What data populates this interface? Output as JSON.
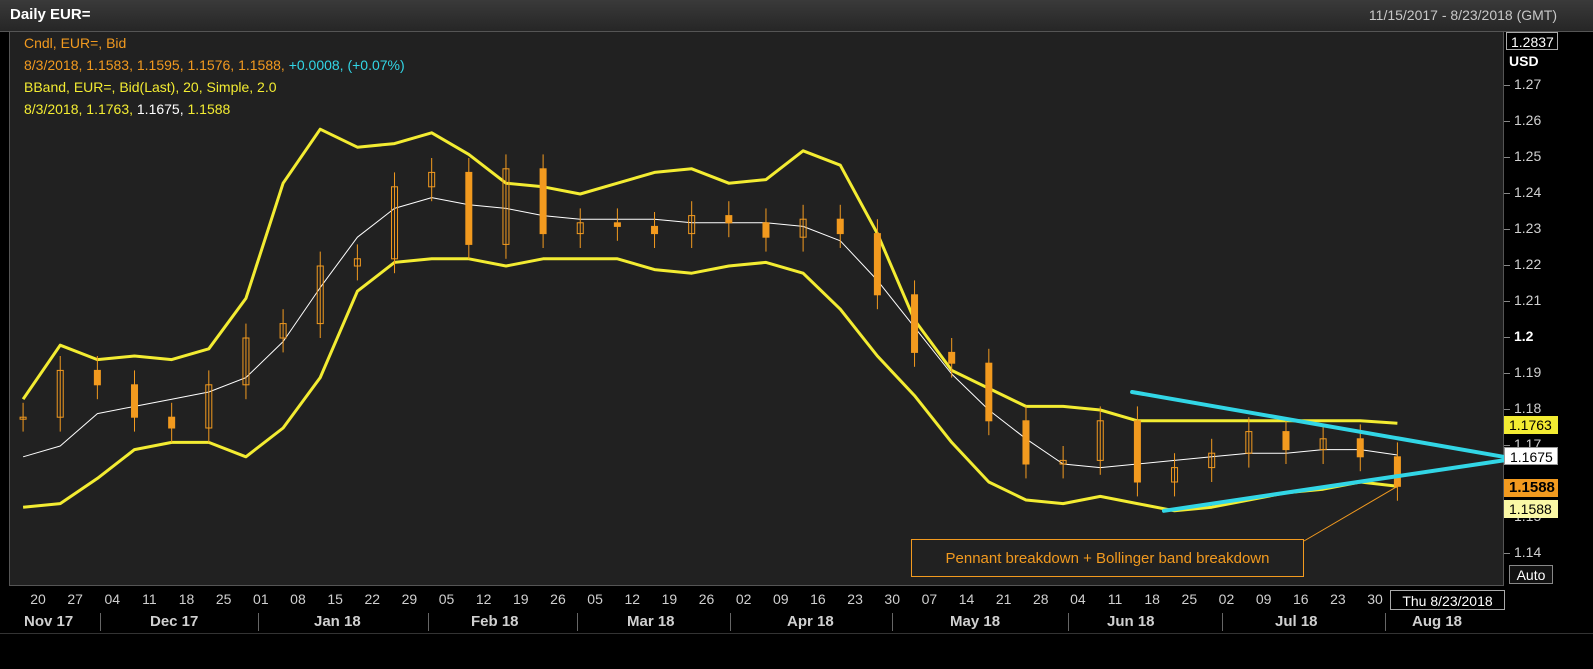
{
  "window": {
    "title": "Daily EUR=",
    "date_range": "11/15/2017 - 8/23/2018 (GMT)"
  },
  "legend": {
    "line1": "Cndl, EUR=, Bid",
    "line2_prefix": "8/3/2018, 1.1583, 1.1595, 1.1576, 1.1588, ",
    "line2_change": "+0.0008, (+0.07%)",
    "line3": "BBand, EUR=, Bid(Last),  20, Simple, 2.0",
    "line4_date": "8/3/2018, ",
    "line4_upper": "1.1763, ",
    "line4_mid": "1.1675, ",
    "line4_lower": "1.1588"
  },
  "yaxis": {
    "unit": "USD",
    "top_value": "1.2837",
    "labels": [
      "1.27",
      "1.26",
      "1.25",
      "1.24",
      "1.23",
      "1.22",
      "1.21",
      "1.2",
      "1.19",
      "1.18",
      "1.17",
      "1.15",
      "1.14"
    ],
    "tags": {
      "upper": "1.1763",
      "mid": "1.1675",
      "last": "1.1588",
      "lower": "1.1588"
    },
    "auto_label": "Auto"
  },
  "xaxis": {
    "day_labels": [
      "20",
      "27",
      "04",
      "11",
      "18",
      "25",
      "01",
      "08",
      "15",
      "22",
      "29",
      "05",
      "12",
      "19",
      "26",
      "05",
      "12",
      "19",
      "26",
      "02",
      "09",
      "16",
      "23",
      "30",
      "07",
      "14",
      "21",
      "28",
      "04",
      "11",
      "18",
      "25",
      "02",
      "09",
      "16",
      "23",
      "30"
    ],
    "months": [
      "Nov 17",
      "Dec 17",
      "Jan 18",
      "Feb 18",
      "Mar 18",
      "Apr 18",
      "May 18",
      "Jun 18",
      "Jul 18",
      "Aug 18"
    ],
    "cursor_date": "Thu 8/23/2018"
  },
  "annotation": "Pennant breakdown + Bollinger band breakdown",
  "colors": {
    "candle": "#f29a1f",
    "band": "#f3ec32",
    "middle": "#ffffff",
    "trendline": "#32d6e6",
    "background": "#212121"
  },
  "chart_data": {
    "type": "candlestick",
    "series": [
      {
        "name": "EUR= Bid",
        "dates": [
          "2017-11-17",
          "2017-11-24",
          "2017-12-01",
          "2017-12-08",
          "2017-12-15",
          "2017-12-22",
          "2017-12-29",
          "2018-01-05",
          "2018-01-12",
          "2018-01-19",
          "2018-01-26",
          "2018-02-02",
          "2018-02-09",
          "2018-02-16",
          "2018-02-23",
          "2018-03-02",
          "2018-03-09",
          "2018-03-16",
          "2018-03-23",
          "2018-03-30",
          "2018-04-06",
          "2018-04-13",
          "2018-04-20",
          "2018-04-27",
          "2018-05-04",
          "2018-05-11",
          "2018-05-18",
          "2018-05-25",
          "2018-06-01",
          "2018-06-08",
          "2018-06-15",
          "2018-06-22",
          "2018-06-29",
          "2018-07-06",
          "2018-07-13",
          "2018-07-20",
          "2018-07-27",
          "2018-08-03"
        ],
        "close": [
          1.178,
          1.191,
          1.187,
          1.178,
          1.175,
          1.187,
          1.2,
          1.204,
          1.22,
          1.222,
          1.242,
          1.246,
          1.226,
          1.247,
          1.229,
          1.232,
          1.231,
          1.229,
          1.234,
          1.232,
          1.228,
          1.233,
          1.229,
          1.212,
          1.196,
          1.193,
          1.177,
          1.165,
          1.166,
          1.177,
          1.16,
          1.164,
          1.168,
          1.174,
          1.169,
          1.172,
          1.167,
          1.1588
        ]
      },
      {
        "name": "BBand upper",
        "values": [
          1.183,
          1.198,
          1.194,
          1.195,
          1.194,
          1.197,
          1.211,
          1.243,
          1.258,
          1.253,
          1.254,
          1.257,
          1.251,
          1.243,
          1.242,
          1.24,
          1.243,
          1.246,
          1.247,
          1.243,
          1.244,
          1.252,
          1.248,
          1.229,
          1.205,
          1.191,
          1.186,
          1.181,
          1.181,
          1.18,
          1.177,
          1.177,
          1.177,
          1.177,
          1.177,
          1.177,
          1.177,
          1.1763
        ]
      },
      {
        "name": "BBand middle",
        "values": [
          1.167,
          1.17,
          1.179,
          1.181,
          1.183,
          1.185,
          1.189,
          1.199,
          1.214,
          1.228,
          1.236,
          1.239,
          1.237,
          1.236,
          1.234,
          1.233,
          1.233,
          1.233,
          1.232,
          1.232,
          1.232,
          1.231,
          1.227,
          1.216,
          1.203,
          1.19,
          1.18,
          1.172,
          1.165,
          1.164,
          1.165,
          1.166,
          1.167,
          1.168,
          1.168,
          1.169,
          1.169,
          1.1675
        ]
      },
      {
        "name": "BBand lower",
        "values": [
          1.153,
          1.154,
          1.161,
          1.169,
          1.171,
          1.171,
          1.167,
          1.175,
          1.189,
          1.213,
          1.221,
          1.222,
          1.222,
          1.22,
          1.222,
          1.222,
          1.222,
          1.219,
          1.218,
          1.22,
          1.221,
          1.218,
          1.208,
          1.195,
          1.184,
          1.171,
          1.16,
          1.155,
          1.154,
          1.156,
          1.154,
          1.152,
          1.153,
          1.155,
          1.157,
          1.158,
          1.16,
          1.1588
        ]
      }
    ],
    "trendlines": [
      {
        "name": "pennant upper",
        "from": [
          "2018-06-14",
          1.185
        ],
        "to": [
          "2018-08-23",
          1.167
        ]
      },
      {
        "name": "pennant lower",
        "from": [
          "2018-06-20",
          1.152
        ],
        "to": [
          "2018-08-23",
          1.166
        ]
      }
    ],
    "ylim": [
      1.131,
      1.2837
    ],
    "xlim": [
      "2017-11-15",
      "2018-08-23"
    ]
  }
}
